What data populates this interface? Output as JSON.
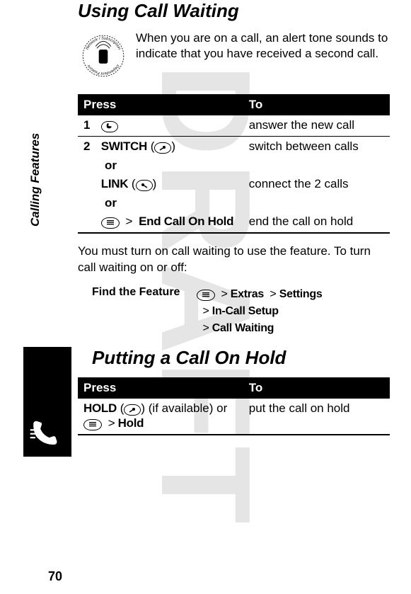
{
  "watermark": "DRAFT",
  "side_tab": "Calling Features",
  "page_number": "70",
  "section1": {
    "title": "Using Call Waiting",
    "intro": "When you are on a call, an alert tone sounds to indicate that you have received a second call.",
    "table": {
      "header_press": "Press",
      "header_to": "To",
      "row1_num": "1",
      "row1_right": "answer the new call",
      "row2_num": "2",
      "row2_switch": "SWITCH",
      "row2_switch_right": "switch between calls",
      "or": "or",
      "row2_link": "LINK",
      "row2_link_right": "connect the 2 calls",
      "row2_end": "End Call On Hold",
      "row2_end_right": "end the call on hold"
    },
    "body_after": "You must turn on call waiting to use the feature. To turn call waiting on or off:",
    "find_feature_label": "Find the Feature",
    "path_extras": "Extras",
    "path_settings": "Settings",
    "path_incall": "In-Call Setup",
    "path_callwaiting": "Call Waiting"
  },
  "section2": {
    "title": "Putting a Call On Hold",
    "table": {
      "header_press": "Press",
      "header_to": "To",
      "hold_label": "HOLD",
      "if_avail": "(if available) or",
      "hold_menu": "Hold",
      "right": "put the call on hold"
    }
  },
  "icons": {
    "network_badge": "network-subscription-dependent-feature",
    "send_key": "send-key",
    "right_soft_key": "right-soft-key",
    "left_soft_key": "left-soft-key",
    "menu_key": "menu-key",
    "phone_icon": "phone-in-call"
  }
}
